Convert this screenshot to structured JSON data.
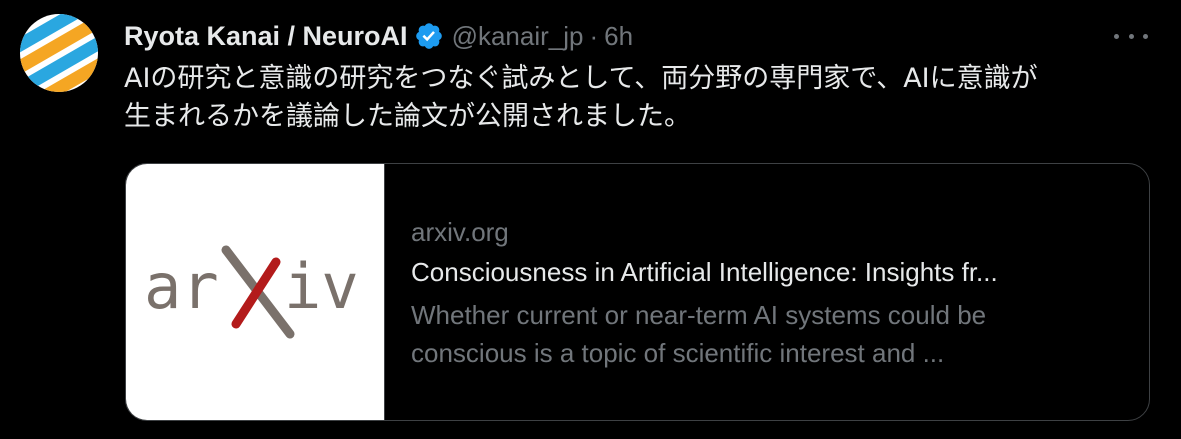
{
  "author": {
    "display_name": "Ryota Kanai / NeuroAI",
    "handle": "@kanair_jp",
    "separator": "·",
    "time": "6h",
    "verified": true,
    "avatar_colors": [
      "#2aa7e0",
      "#f5a623",
      "#ffffff"
    ]
  },
  "tweet": {
    "text_lines": [
      "AIの研究と意識の研究をつなぐ試みとして、両分野の専門家で、AIに意識が",
      "生まれるかを議論した論文が公開されました。"
    ]
  },
  "card": {
    "domain": "arxiv.org",
    "title": "Consciousness in Artificial Intelligence: Insights fr...",
    "description_lines": [
      "Whether current or near-term AI systems could be",
      "conscious is a topic of scientific interest and ..."
    ],
    "logo_text": "arXiv",
    "logo_colors": {
      "text": "#7a716b",
      "x_red": "#b31b1b",
      "x_gray": "#7a716b"
    }
  },
  "colors": {
    "background": "#000000",
    "primary_text": "#e7e9ea",
    "secondary_text": "#71767b",
    "verified_blue": "#1d9bf0",
    "card_border": "#3e4144"
  },
  "icons": {
    "verified": "verified-badge-icon",
    "more": "more-horizontal-icon"
  }
}
